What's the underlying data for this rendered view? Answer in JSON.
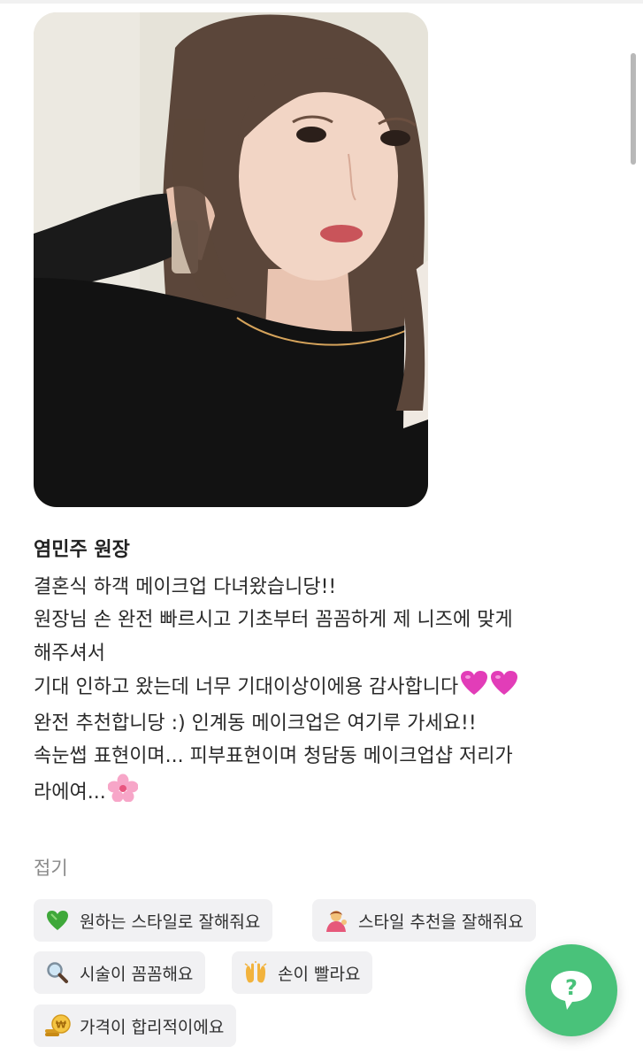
{
  "review": {
    "author": "염민주 원장",
    "lines": [
      "결혼식 하객 메이크업 다녀왔습니당!!",
      "원장님 손 완전 빠르시고 기초부터 꼼꼼하게 제 니즈에 맞게",
      "해주셔서",
      "기대 인하고 왔는데 너무 기대이상이에용 감사합니다",
      "완전 추천합니당 :) 인계동 메이크업은 여기루 가세요!!",
      "속눈썹 표현이며... 피부표현이며 청담동 메이크업샵 저리가",
      "라에여..."
    ],
    "fold_label": "접기"
  },
  "tags": [
    {
      "icon": "green-heart-icon",
      "label": "원하는 스타일로 잘해줘요"
    },
    {
      "icon": "person-tipping-hand-icon",
      "label": "스타일 추천을 잘해줘요"
    },
    {
      "icon": "magnifying-glass-icon",
      "label": "시술이 꼼꼼해요"
    },
    {
      "icon": "raising-hands-icon",
      "label": "손이 빨라요"
    },
    {
      "icon": "won-coin-icon",
      "label": "가격이 합리적이에요"
    }
  ],
  "colors": {
    "fab": "#49c27a",
    "tag_bg": "#f1f1f3",
    "heart": "#e23db8",
    "blossom": "#f7a6c8"
  },
  "fab": {
    "icon": "question-bubble-icon"
  }
}
